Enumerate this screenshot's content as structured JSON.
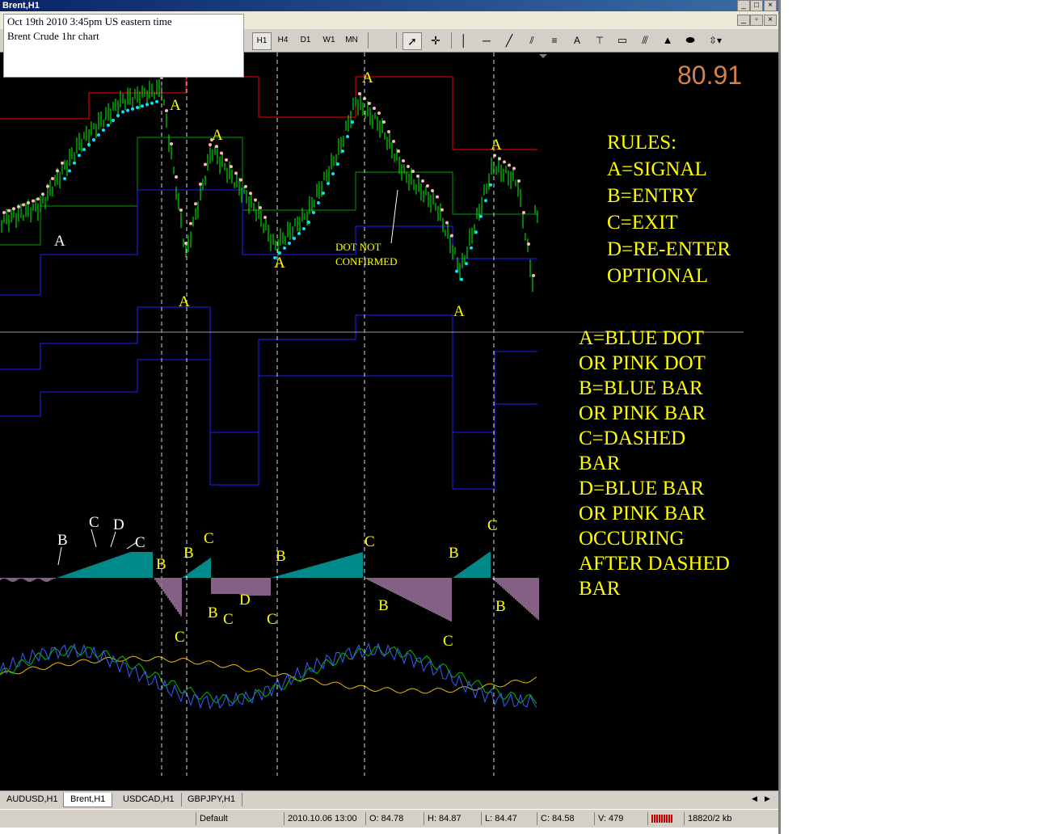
{
  "window": {
    "title": "Brent,H1"
  },
  "note": {
    "line1": "Oct 19th 2010 3:45pm  US eastern time",
    "line2": "Brent Crude 1hr chart"
  },
  "toolbar": {
    "periods": [
      "H1",
      "H4",
      "D1",
      "W1",
      "MN"
    ],
    "active_period": "H1",
    "tools": [
      "cursor-icon",
      "crosshair-icon",
      "vertical-line-icon",
      "horizontal-line-icon",
      "trendline-icon",
      "gann-icon",
      "fibonacci-icon",
      "text-icon",
      "text-label-icon",
      "rectangle-icon",
      "channel-icon",
      "triangle-icon",
      "ellipse-icon",
      "arrows-icon"
    ],
    "text_tool_label": "A"
  },
  "chart": {
    "price": "80.91",
    "rules": [
      "RULES:",
      "A=SIGNAL",
      "B=ENTRY",
      "C=EXIT",
      "D=RE-ENTER",
      "OPTIONAL"
    ],
    "definitions": [
      "A=BLUE DOT",
      "OR PINK DOT",
      "B=BLUE BAR",
      "OR PINK BAR",
      "C=DASHED",
      "BAR",
      "D=BLUE BAR",
      "OR PINK BAR",
      "OCCURING",
      "AFTER DASHED",
      "BAR"
    ],
    "dot_note": [
      "DOT NOT",
      "CONFIRMED"
    ],
    "signal_labels": {
      "a1": "A",
      "a2": "A",
      "a3": "A",
      "a4": "A",
      "a5": "A",
      "a6": "A",
      "a7": "A",
      "a8": "A"
    },
    "histogram_labels": {
      "b1": "B",
      "c1": "C",
      "d1": "D",
      "c2": "C",
      "b2": "B",
      "b3": "B",
      "c3": "C",
      "b4": "B",
      "c4": "C",
      "d2": "D",
      "c5": "C",
      "b5": "B",
      "c6": "C",
      "c7": "C",
      "b6": "B",
      "b7": "B",
      "c8": "C",
      "b8": "B",
      "c9": "C"
    },
    "colors": {
      "background": "#000000",
      "up_bar": "#00ff00",
      "blue_dot": "#00e5ff",
      "pink_dot": "#ffb6c1",
      "blue_hist": "#00e5e5",
      "pink_hist": "#dda0dd",
      "label": "#ffff00",
      "price": "#d2834a"
    }
  },
  "tabs": {
    "items": [
      "AUDUSD,H1",
      "Brent,H1",
      "USDCAD,H1",
      "GBPJPY,H1"
    ],
    "active": "Brent,H1"
  },
  "status": {
    "profile": "Default",
    "datetime": "2010.10.06 13:00",
    "open": "O: 84.78",
    "high": "H: 84.87",
    "low": "L: 84.47",
    "close": "C: 84.58",
    "volume": "V: 479",
    "traffic": "18820/2 kb"
  }
}
